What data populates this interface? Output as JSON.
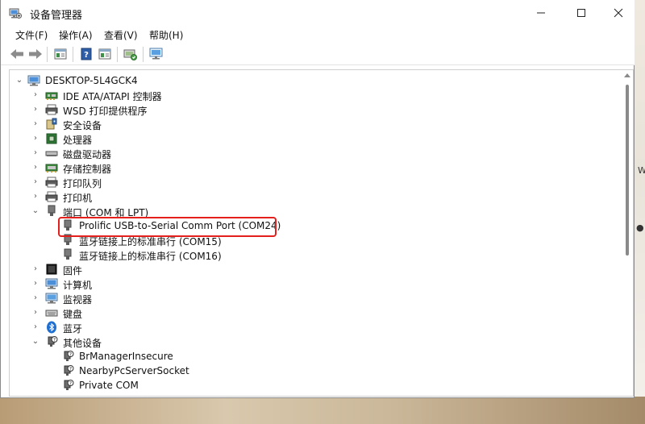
{
  "window": {
    "title": "设备管理器",
    "controls": [
      "minimize",
      "maximize",
      "close"
    ]
  },
  "menu": [
    {
      "label": "文件(F)"
    },
    {
      "label": "操作(A)"
    },
    {
      "label": "查看(V)"
    },
    {
      "label": "帮助(H)"
    }
  ],
  "toolbar": [
    "back-icon",
    "forward-icon",
    "properties-icon",
    "help-icon",
    "driver-icon",
    "scan-hardware-icon",
    "monitor-icon"
  ],
  "tree": {
    "root": "DESKTOP-5L4GCK4",
    "items": [
      {
        "label": "IDE ATA/ATAPI 控制器",
        "icon": "ide-controller-icon",
        "expanded": false,
        "level": 1
      },
      {
        "label": "WSD 打印提供程序",
        "icon": "wsd-printer-icon",
        "expanded": false,
        "level": 1
      },
      {
        "label": "安全设备",
        "icon": "security-device-icon",
        "expanded": false,
        "level": 1
      },
      {
        "label": "处理器",
        "icon": "processor-icon",
        "expanded": false,
        "level": 1
      },
      {
        "label": "磁盘驱动器",
        "icon": "disk-drive-icon",
        "expanded": false,
        "level": 1
      },
      {
        "label": "存储控制器",
        "icon": "storage-controller-icon",
        "expanded": false,
        "level": 1
      },
      {
        "label": "打印队列",
        "icon": "print-queue-icon",
        "expanded": false,
        "level": 1
      },
      {
        "label": "打印机",
        "icon": "printer-icon",
        "expanded": false,
        "level": 1
      },
      {
        "label": "端口 (COM 和 LPT)",
        "icon": "port-icon",
        "expanded": true,
        "level": 1
      },
      {
        "label": "Prolific USB-to-Serial Comm Port (COM24)",
        "icon": "port-icon",
        "level": 2,
        "highlighted": true
      },
      {
        "label": "蓝牙链接上的标准串行 (COM15)",
        "icon": "port-icon",
        "level": 2
      },
      {
        "label": "蓝牙链接上的标准串行 (COM16)",
        "icon": "port-icon",
        "level": 2
      },
      {
        "label": "固件",
        "icon": "firmware-icon",
        "expanded": false,
        "level": 1
      },
      {
        "label": "计算机",
        "icon": "computer-icon",
        "expanded": false,
        "level": 1
      },
      {
        "label": "监视器",
        "icon": "monitor-icon",
        "expanded": false,
        "level": 1
      },
      {
        "label": "键盘",
        "icon": "keyboard-icon",
        "expanded": false,
        "level": 1
      },
      {
        "label": "蓝牙",
        "icon": "bluetooth-icon",
        "expanded": false,
        "level": 1
      },
      {
        "label": "其他设备",
        "icon": "unknown-device-icon",
        "expanded": true,
        "level": 1
      },
      {
        "label": "BrManagerInsecure",
        "icon": "unknown-device-icon",
        "level": 2
      },
      {
        "label": "NearbyPcServerSocket",
        "icon": "unknown-device-icon",
        "level": 2
      },
      {
        "label": "Private COM",
        "icon": "unknown-device-icon",
        "level": 2
      }
    ]
  },
  "colors": {
    "highlight_border": "#e3201b",
    "scrollbar_thumb": "#8a8a8a"
  }
}
